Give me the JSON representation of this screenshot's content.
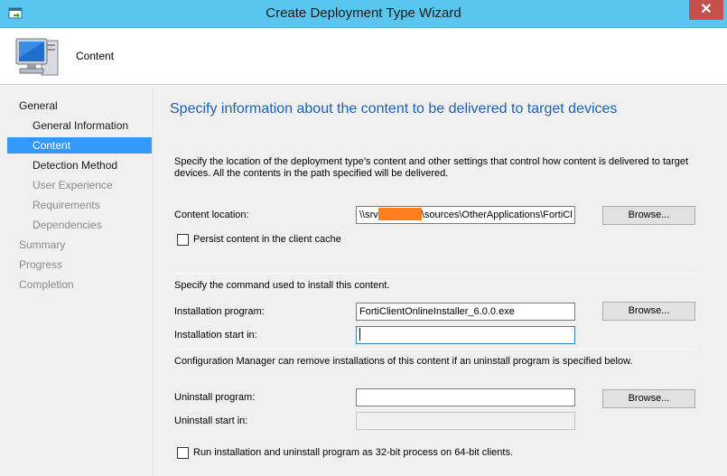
{
  "window": {
    "title": "Create Deployment Type Wizard",
    "close_glyph": "✕"
  },
  "header": {
    "step_title": "Content",
    "icon": "computer-icon"
  },
  "sidebar": {
    "items": [
      {
        "label": "General",
        "kind": "group",
        "state": "normal"
      },
      {
        "label": "General Information",
        "kind": "sub",
        "state": "normal"
      },
      {
        "label": "Content",
        "kind": "sub",
        "state": "selected"
      },
      {
        "label": "Detection Method",
        "kind": "sub",
        "state": "normal"
      },
      {
        "label": "User Experience",
        "kind": "sub",
        "state": "disabled"
      },
      {
        "label": "Requirements",
        "kind": "sub",
        "state": "disabled"
      },
      {
        "label": "Dependencies",
        "kind": "sub",
        "state": "disabled"
      },
      {
        "label": "Summary",
        "kind": "group",
        "state": "disabled"
      },
      {
        "label": "Progress",
        "kind": "group",
        "state": "disabled"
      },
      {
        "label": "Completion",
        "kind": "group",
        "state": "disabled"
      }
    ]
  },
  "main": {
    "heading": "Specify information about the content to be delivered to target devices",
    "description": "Specify the location of the deployment type’s content and other settings that control how content is delivered to target devices. All the contents in the path specified will be delivered.",
    "content_location": {
      "label": "Content location:",
      "value_prefix": "\\\\srv",
      "value_suffix": "\\sources\\OtherApplications\\FortiCl",
      "browse_label": "Browse..."
    },
    "persist_cache": {
      "label": "Persist content in the client cache",
      "checked": false
    },
    "install_section": {
      "caption": "Specify the command used to install this content.",
      "program_label": "Installation program:",
      "program_value": "FortiClientOnlineInstaller_6.0.0.exe",
      "browse_label": "Browse...",
      "start_in_label": "Installation start in:",
      "start_in_value": ""
    },
    "uninstall_section": {
      "caption": "Configuration Manager can remove installations of this content if an uninstall program is specified below.",
      "program_label": "Uninstall program:",
      "program_value": "",
      "browse_label": "Browse...",
      "start_in_label": "Uninstall start in:",
      "start_in_value": ""
    },
    "run_32bit": {
      "label": "Run installation and uninstall program as 32-bit process on 64-bit clients.",
      "checked": false
    }
  }
}
